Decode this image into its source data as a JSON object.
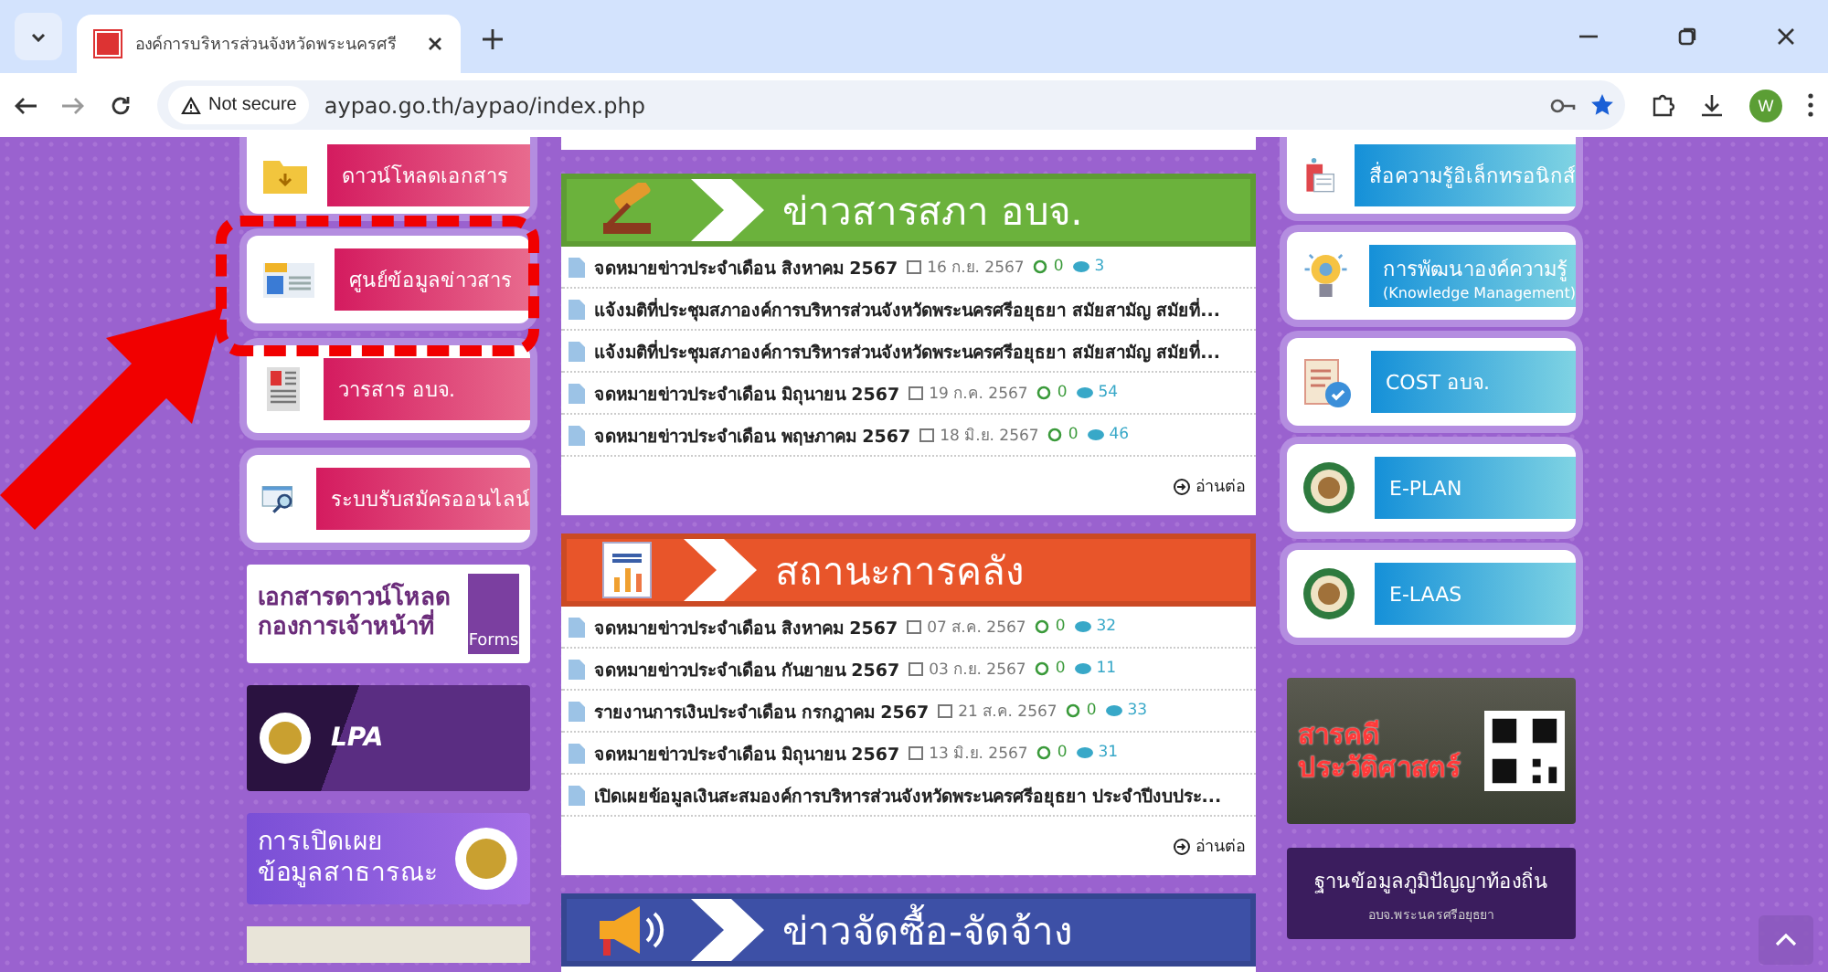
{
  "browser": {
    "tab": {
      "title": "องค์การบริหารส่วนจังหวัดพระนครศรี",
      "selected": true
    },
    "security": "Not secure",
    "url": "aypao.go.th/aypao/index.php",
    "avatar": "W"
  },
  "left_menu": [
    {
      "label": "ดาวน์โหลดเอกสาร"
    },
    {
      "label": "ศูนย์ข้อมูลข่าวสาร"
    },
    {
      "label": "วารสาร อบจ."
    },
    {
      "label": "ระบบรับสมัครออนไลน์"
    }
  ],
  "left_banners": [
    {
      "kind": "forms",
      "lines": [
        "เอกสารดาวน์โหลด",
        "กองการเจ้าหน้าที่"
      ],
      "badge": "Forms"
    },
    {
      "kind": "lpa",
      "lines": [
        "LPA"
      ]
    },
    {
      "kind": "disclosure",
      "lines": [
        "การเปิดเผย",
        "ข้อมูลสาธารณะ"
      ]
    }
  ],
  "panels": [
    {
      "title": "ข่าวสารสภา อบจ.",
      "color": "#6bb23c",
      "read_more": "อ่านต่อ",
      "rows": [
        {
          "title": "จดหมายข่าวประจำเดือน สิงหาคม 2567",
          "date": "16 ก.ย. 2567",
          "comments": "0",
          "views": "3"
        },
        {
          "title": "แจ้งมติที่ประชุมสภาองค์การบริหารส่วนจังหวัดพระนครศรีอยุธยา สมัยสามัญ สมัยที่..."
        },
        {
          "title": "แจ้งมติที่ประชุมสภาองค์การบริหารส่วนจังหวัดพระนครศรีอยุธยา สมัยสามัญ สมัยที่..."
        },
        {
          "title": "จดหมายข่าวประจำเดือน มิถุนายน 2567",
          "date": "19 ก.ค. 2567",
          "comments": "0",
          "views": "54"
        },
        {
          "title": "จดหมายข่าวประจำเดือน พฤษภาคม 2567",
          "date": "18 มิ.ย. 2567",
          "comments": "0",
          "views": "46"
        }
      ]
    },
    {
      "title": "สถานะการคลัง",
      "color": "#e8552a",
      "read_more": "อ่านต่อ",
      "rows": [
        {
          "title": "จดหมายข่าวประจำเดือน สิงหาคม 2567",
          "date": "07 ส.ค. 2567",
          "comments": "0",
          "views": "32"
        },
        {
          "title": "จดหมายข่าวประจำเดือน กันยายน 2567",
          "date": "03 ก.ย. 2567",
          "comments": "0",
          "views": "11"
        },
        {
          "title": "รายงานการเงินประจำเดือน กรกฎาคม 2567",
          "date": "21 ส.ค. 2567",
          "comments": "0",
          "views": "33"
        },
        {
          "title": "จดหมายข่าวประจำเดือน มิถุนายน 2567",
          "date": "13 มิ.ย. 2567",
          "comments": "0",
          "views": "31"
        },
        {
          "title": "เปิดเผยข้อมูลเงินสะสมองค์การบริหารส่วนจังหวัดพระนครศรีอยุธยา ประจำปีงบประ..."
        }
      ]
    },
    {
      "title": "ข่าวจัดซื้อ-จัดจ้าง",
      "color": "#3d50a6"
    }
  ],
  "right_menu": [
    {
      "lines": [
        "สื่อความรู้อิเล็กทรอนิกส์"
      ]
    },
    {
      "lines": [
        "การพัฒนาองค์ความรู้",
        "(Knowledge Management)"
      ]
    },
    {
      "lines": [
        "COST อบจ."
      ]
    },
    {
      "lines": [
        "E-PLAN"
      ]
    },
    {
      "lines": [
        "E-LAAS"
      ]
    }
  ],
  "right_banners": [
    {
      "kind": "documentary",
      "lines": [
        "สารคดี",
        "ประวัติศาสตร์"
      ]
    },
    {
      "kind": "wisdom",
      "lines": [
        "ฐานข้อมูลภูมิปัญญาท้องถิ่น",
        "อบจ.พระนครศรีอยุธยา"
      ]
    }
  ]
}
